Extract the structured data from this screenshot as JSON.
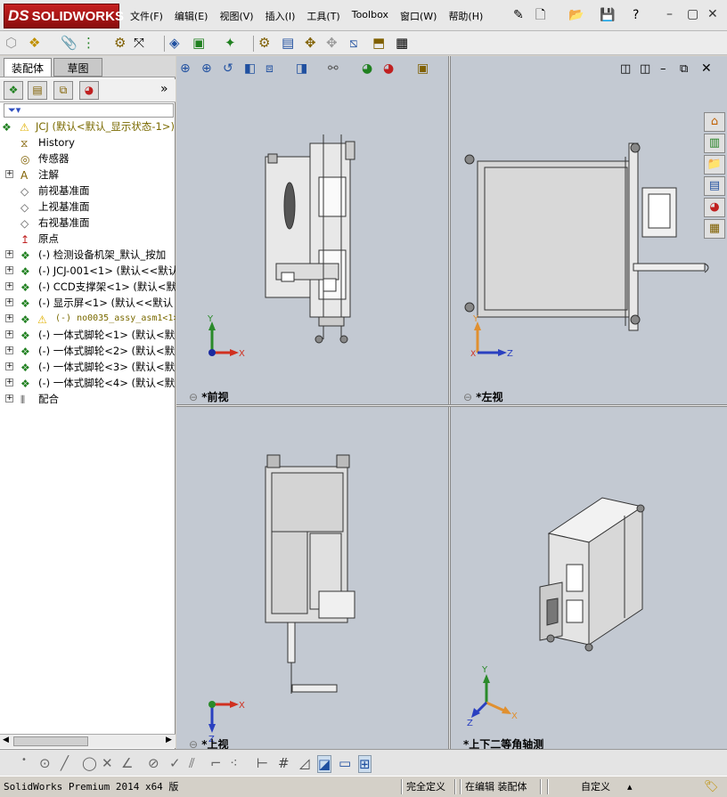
{
  "app": {
    "brand_prefix": "DS",
    "brand": "SOLIDWORKS"
  },
  "menu": [
    "文件(F)",
    "编辑(E)",
    "视图(V)",
    "插入(I)",
    "工具(T)",
    "Toolbox",
    "窗口(W)",
    "帮助(H)"
  ],
  "tabs": {
    "assembly": "装配体",
    "sketch": "草图"
  },
  "tree": {
    "root": "JCJ  (默认<默认_显示状态-1>)",
    "items": [
      {
        "label": "History",
        "icon": "history-icon",
        "expandable": false
      },
      {
        "label": "传感器",
        "icon": "sensor-icon",
        "expandable": false
      },
      {
        "label": "注解",
        "icon": "annotation-icon",
        "expandable": true
      },
      {
        "label": "前视基准面",
        "icon": "plane-icon",
        "expandable": false
      },
      {
        "label": "上视基准面",
        "icon": "plane-icon",
        "expandable": false
      },
      {
        "label": "右视基准面",
        "icon": "plane-icon",
        "expandable": false
      },
      {
        "label": "原点",
        "icon": "origin-icon",
        "expandable": false
      },
      {
        "label": "(-) 检测设备机架_默认_按加",
        "icon": "subassembly-icon",
        "expandable": true
      },
      {
        "label": "(-) JCJ-001<1> (默认<<默认",
        "icon": "subassembly-icon",
        "expandable": true
      },
      {
        "label": "(-) CCD支撑架<1> (默认<默认",
        "icon": "subassembly-icon",
        "expandable": true
      },
      {
        "label": "(-) 显示屏<1> (默认<<默认",
        "icon": "subassembly-icon",
        "expandable": true
      },
      {
        "label": "(-) no0035_assy_asm1<1>",
        "icon": "warning-subassembly-icon",
        "expandable": true,
        "warning": true
      },
      {
        "label": "(-) 一体式脚轮<1> (默认<默",
        "icon": "subassembly-icon",
        "expandable": true
      },
      {
        "label": "(-) 一体式脚轮<2> (默认<默",
        "icon": "subassembly-icon",
        "expandable": true
      },
      {
        "label": "(-) 一体式脚轮<3> (默认<默",
        "icon": "subassembly-icon",
        "expandable": true
      },
      {
        "label": "(-) 一体式脚轮<4> (默认<默",
        "icon": "subassembly-icon",
        "expandable": true
      },
      {
        "label": "配合",
        "icon": "mates-icon",
        "expandable": true
      }
    ]
  },
  "viewports": {
    "front": "*前视",
    "left": "*左视",
    "top": "*上视",
    "iso": "*上下二等角轴测"
  },
  "axes": {
    "x": "X",
    "y": "Y",
    "z": "Z"
  },
  "status": {
    "product": "SolidWorks Premium 2014 x64 版",
    "definition": "完全定义",
    "editing": "在编辑 装配体",
    "units": "自定义",
    "units_arrow": "▴"
  },
  "colors": {
    "viewport_bg": "#c3c9d2",
    "brand_red": "#b01818",
    "warning": "#e0b000",
    "tree_root": "#7a6a00"
  }
}
